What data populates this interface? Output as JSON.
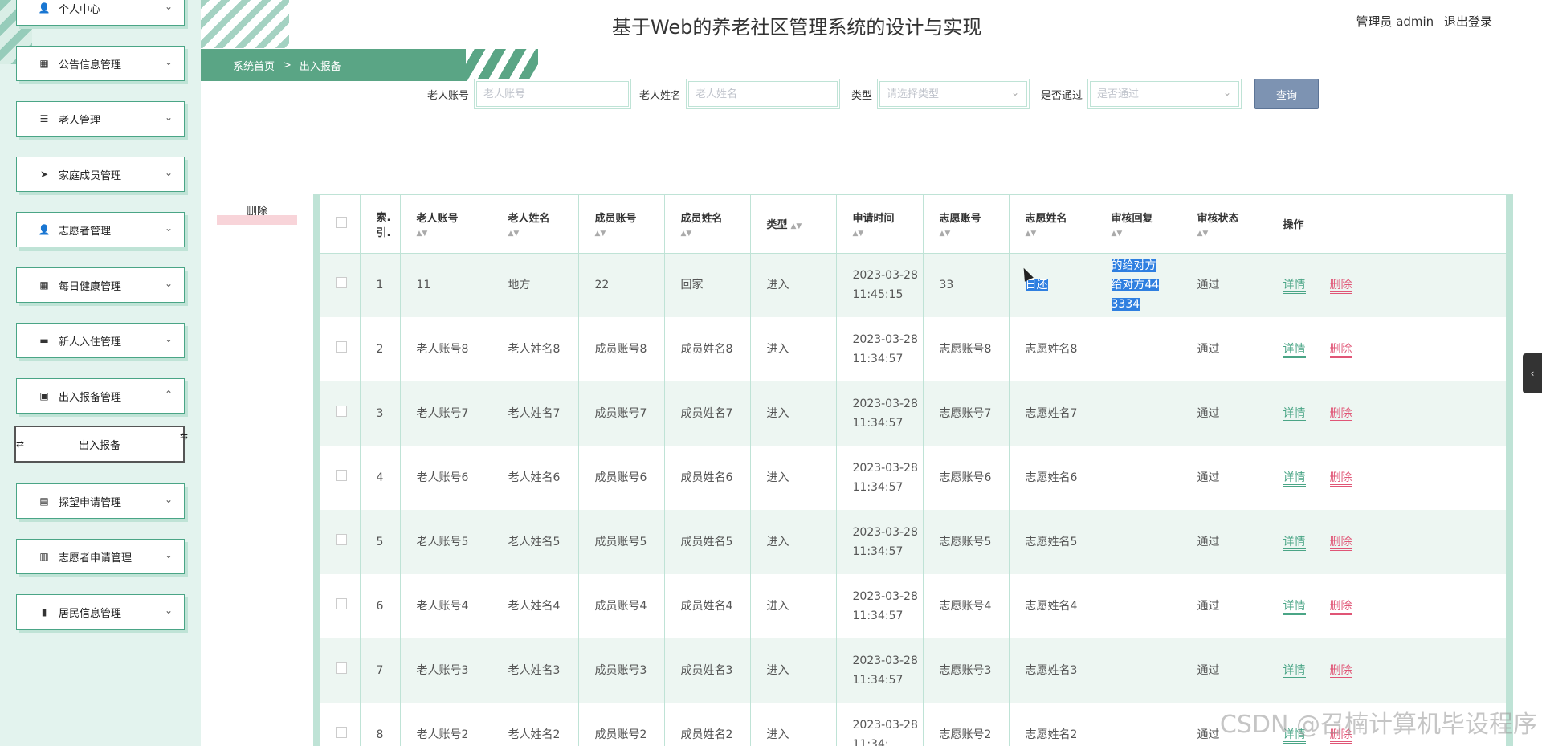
{
  "header": {
    "title": "基于Web的养老社区管理系统的设计与实现",
    "user_label": "管理员 admin",
    "logout_label": "退出登录"
  },
  "sidebar": {
    "items": [
      {
        "label": "个人中心",
        "icon": "person-icon"
      },
      {
        "label": "公告信息管理",
        "icon": "grid-icon"
      },
      {
        "label": "老人管理",
        "icon": "list-icon"
      },
      {
        "label": "家庭成员管理",
        "icon": "send-icon"
      },
      {
        "label": "志愿者管理",
        "icon": "user-icon"
      },
      {
        "label": "每日健康管理",
        "icon": "grid-icon"
      },
      {
        "label": "新人入住管理",
        "icon": "bed-icon"
      },
      {
        "label": "出入报备管理",
        "icon": "wallet-icon"
      },
      {
        "label": "探望申请管理",
        "icon": "clipboard-icon"
      },
      {
        "label": "志愿者申请管理",
        "icon": "briefcase-icon"
      },
      {
        "label": "居民信息管理",
        "icon": "book-icon"
      }
    ],
    "active_sub": "出入报备"
  },
  "breadcrumb": {
    "home": "系统首页",
    "sep": ">",
    "current": "出入报备"
  },
  "search": {
    "account_label": "老人账号",
    "account_placeholder": "老人账号",
    "name_label": "老人姓名",
    "name_placeholder": "老人姓名",
    "type_label": "类型",
    "type_placeholder": "请选择类型",
    "passed_label": "是否通过",
    "passed_placeholder": "是否通过",
    "query_label": "查询"
  },
  "batch_delete_label": "删除",
  "table": {
    "headers": [
      "索.引.",
      "老人账号",
      "老人姓名",
      "成员账号",
      "成员姓名",
      "类型",
      "申请时间",
      "志愿账号",
      "志愿姓名",
      "审核回复",
      "审核状态",
      "操作"
    ],
    "rows": [
      {
        "idx": "1",
        "acct": "11",
        "name": "地方",
        "macct": "22",
        "mname": "回家",
        "type": "进入",
        "time": "2023-03-28 11:45:15",
        "vacct": "33",
        "vname": "日还",
        "reply": "的给对方给对方443334",
        "status": "通过"
      },
      {
        "idx": "2",
        "acct": "老人账号8",
        "name": "老人姓名8",
        "macct": "成员账号8",
        "mname": "成员姓名8",
        "type": "进入",
        "time": "2023-03-28 11:34:57",
        "vacct": "志愿账号8",
        "vname": "志愿姓名8",
        "reply": "",
        "status": "通过"
      },
      {
        "idx": "3",
        "acct": "老人账号7",
        "name": "老人姓名7",
        "macct": "成员账号7",
        "mname": "成员姓名7",
        "type": "进入",
        "time": "2023-03-28 11:34:57",
        "vacct": "志愿账号7",
        "vname": "志愿姓名7",
        "reply": "",
        "status": "通过"
      },
      {
        "idx": "4",
        "acct": "老人账号6",
        "name": "老人姓名6",
        "macct": "成员账号6",
        "mname": "成员姓名6",
        "type": "进入",
        "time": "2023-03-28 11:34:57",
        "vacct": "志愿账号6",
        "vname": "志愿姓名6",
        "reply": "",
        "status": "通过"
      },
      {
        "idx": "5",
        "acct": "老人账号5",
        "name": "老人姓名5",
        "macct": "成员账号5",
        "mname": "成员姓名5",
        "type": "进入",
        "time": "2023-03-28 11:34:57",
        "vacct": "志愿账号5",
        "vname": "志愿姓名5",
        "reply": "",
        "status": "通过"
      },
      {
        "idx": "6",
        "acct": "老人账号4",
        "name": "老人姓名4",
        "macct": "成员账号4",
        "mname": "成员姓名4",
        "type": "进入",
        "time": "2023-03-28 11:34:57",
        "vacct": "志愿账号4",
        "vname": "志愿姓名4",
        "reply": "",
        "status": "通过"
      },
      {
        "idx": "7",
        "acct": "老人账号3",
        "name": "老人姓名3",
        "macct": "成员账号3",
        "mname": "成员姓名3",
        "type": "进入",
        "time": "2023-03-28 11:34:57",
        "vacct": "志愿账号3",
        "vname": "志愿姓名3",
        "reply": "",
        "status": "通过"
      },
      {
        "idx": "8",
        "acct": "老人账号2",
        "name": "老人姓名2",
        "macct": "成员账号2",
        "mname": "成员姓名2",
        "type": "进入",
        "time": "2023-03-28 11:34:",
        "vacct": "志愿账号2",
        "vname": "志愿姓名2",
        "reply": "",
        "status": "通过"
      }
    ],
    "detail_label": "详情",
    "delete_label": "删除"
  },
  "watermark": "CSDN @召楠计算机毕设程序",
  "colors": {
    "accent": "#4aa586",
    "row_alt": "#edf6f2",
    "danger": "#e05576",
    "query_btn": "#7d93b2"
  }
}
